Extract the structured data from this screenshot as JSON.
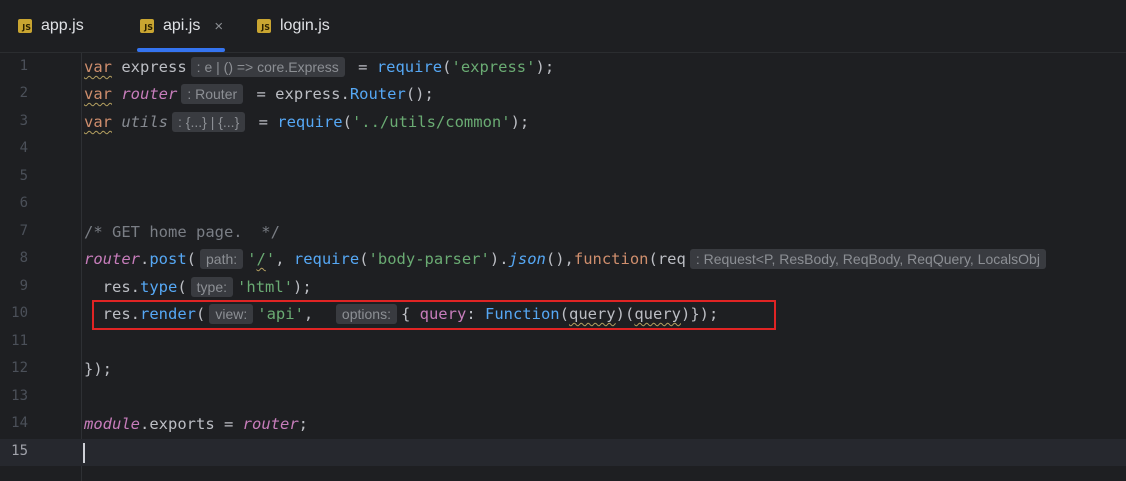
{
  "tabs": [
    {
      "label": "app.js",
      "icon": "JS"
    },
    {
      "label": "api.js",
      "icon": "JS",
      "active": true
    },
    {
      "label": "login.js",
      "icon": "JS"
    }
  ],
  "tab_close_symbol": "×",
  "line_numbers": [
    "1",
    "2",
    "3",
    "4",
    "5",
    "6",
    "7",
    "8",
    "9",
    "10",
    "11",
    "12",
    "13",
    "14",
    "15"
  ],
  "code": {
    "l1": {
      "var": "var",
      "name": "express",
      "hint": ": e | () => core.Express",
      "eq": " = ",
      "require": "require",
      "open": "(",
      "mod": "'express'",
      "close": ");"
    },
    "l2": {
      "var": "var",
      "name": "router",
      "hint": ": Router",
      "eq": " = express.",
      "fn": "Router",
      "close": "();"
    },
    "l3": {
      "var": "var",
      "name": "utils",
      "hint": ": {...} | {...}",
      "eq": " = ",
      "require": "require",
      "open": "(",
      "mod": "'../utils/common'",
      "close": ");"
    },
    "l7": {
      "comment": "/* GET home page.  */"
    },
    "l8": {
      "obj": "router",
      "dot": ".",
      "fn": "post",
      "open": "(",
      "hint_path": "path:",
      "q1": "'",
      "slash": "/",
      "q2": "'",
      "comma": ", ",
      "require": "require",
      "open2": "(",
      "mod": "'body-parser'",
      "mid": ").",
      "json": "json",
      "mid2": "(),",
      "function": "function",
      "open3": "(req",
      "hint": ": Request<P, ResBody, ReqBody, ReqQuery, LocalsObj"
    },
    "l9": {
      "indent": "  ",
      "obj": "res.",
      "fn": "type",
      "open": "(",
      "hint": "type:",
      "str": "'html'",
      "close": ");"
    },
    "l10": {
      "indent": "  ",
      "obj": "res.",
      "fn": "render",
      "open": "(",
      "hint_view": "view:",
      "str": "'api'",
      "comma": ",  ",
      "hint_options": "options:",
      "brace": "{ ",
      "query": "query",
      "colon": ": ",
      "func": "Function",
      "a1": "(",
      "q1": "query",
      "a2": ")(",
      "q2": "query",
      "a3": ")});"
    },
    "l12": {
      "text": "});"
    },
    "l14": {
      "module": "module",
      "dot": ".",
      "exports": "exports",
      "eq": " = ",
      "router": "router",
      "semi": ";"
    }
  }
}
